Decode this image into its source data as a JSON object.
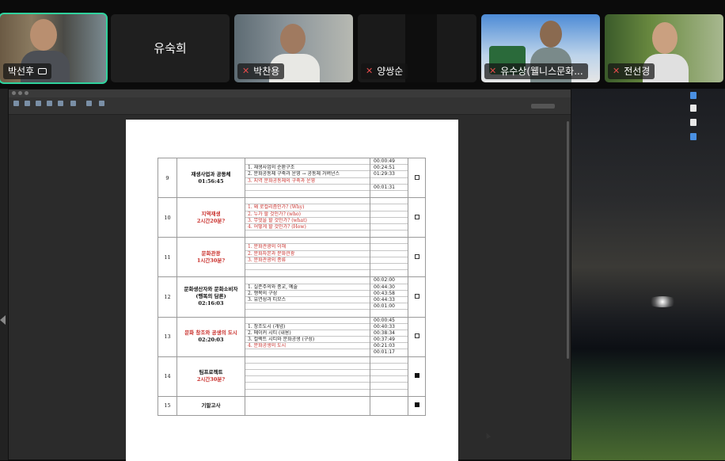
{
  "participants": [
    {
      "name": "박선후",
      "active": true,
      "muted": false,
      "camera": true
    },
    {
      "name": "유숙희",
      "muted": false,
      "video": false
    },
    {
      "name": "박찬용",
      "muted": true
    },
    {
      "name": "양쌍순",
      "muted": true
    },
    {
      "name": "유수상(웰니스문화...",
      "muted": true
    },
    {
      "name": "전선경",
      "muted": true
    }
  ],
  "icons": {
    "mic_off": "mic-off-icon",
    "camera": "camera-icon"
  },
  "colors": {
    "active_speaker": "#2fd29d",
    "red_text": "#c9302c"
  },
  "schedule": {
    "rows": [
      {
        "num": "9",
        "title": "재생사업과 공동체",
        "title_sub": "01:56:45",
        "title_red": false,
        "items": [
          {
            "text": "",
            "red": false
          },
          {
            "text": "1. 재생사업의 순환구조",
            "red": false
          },
          {
            "text": "2. 문화공동체 구축과 운영 → 공동체 거버넌스",
            "red": false
          },
          {
            "text": "3. 지역 문화공동체의 구축과 운영",
            "red": true
          },
          {
            "text": "",
            "red": false
          },
          {
            "text": "",
            "red": false
          }
        ],
        "times": [
          "00:00:49",
          "00:24:51",
          "01:29:33",
          "",
          "00:01:31",
          ""
        ],
        "check": "empty"
      },
      {
        "num": "10",
        "title": "지역재생",
        "title_sub": "2시간20분?",
        "title_red": true,
        "items": [
          {
            "text": "",
            "red": false
          },
          {
            "text": "1. 왜 로컬리즘인가? (Why)",
            "red": true
          },
          {
            "text": "2. 누가 할 것인가? (who)",
            "red": true
          },
          {
            "text": "3. 무엇을 할 것인가? (what)",
            "red": true
          },
          {
            "text": "4. 어떻게 할 것인가? (How)",
            "red": true
          },
          {
            "text": "",
            "red": false
          }
        ],
        "times": [
          "",
          "",
          "",
          "",
          "",
          ""
        ],
        "check": "empty"
      },
      {
        "num": "11",
        "title": "문화관광",
        "title_sub": "1시간30분?",
        "title_red": true,
        "items": [
          {
            "text": "",
            "red": false
          },
          {
            "text": "1. 문화관광의 이해",
            "red": true
          },
          {
            "text": "2. 문화자본과 문화관광",
            "red": true
          },
          {
            "text": "3. 문화관광의 종류",
            "red": true
          },
          {
            "text": "",
            "red": false
          },
          {
            "text": "",
            "red": false
          }
        ],
        "times": [
          "",
          "",
          "",
          "",
          "",
          ""
        ],
        "check": "empty"
      },
      {
        "num": "12",
        "title": "문화생산자와 문화소비자",
        "title_mid": "(행복의 담론)",
        "title_sub": "02:16:03",
        "title_red": false,
        "items": [
          {
            "text": "",
            "red": false
          },
          {
            "text": "1. 실존주의와 종교, 예술",
            "red": false
          },
          {
            "text": "2. 행복의 구성",
            "red": false
          },
          {
            "text": "3. 유연성과 티모스",
            "red": false
          },
          {
            "text": "",
            "red": false
          },
          {
            "text": "",
            "red": false
          }
        ],
        "times": [
          "00:02:00",
          "00:44:30",
          "00:43:58",
          "00:44:33",
          "00:01:00",
          ""
        ],
        "check": "empty"
      },
      {
        "num": "13",
        "title": "문화 창조와 공생의 도시",
        "title_sub": "02:20:03",
        "title_red": true,
        "title_sub_red": false,
        "items": [
          {
            "text": "",
            "red": false
          },
          {
            "text": "1. 창조도시 (개념)",
            "red": false
          },
          {
            "text": "2. 메이커 시티 (내용)",
            "red": false
          },
          {
            "text": "3. 컬렉트 시티와 문화공생 (구성)",
            "red": false
          },
          {
            "text": "4. 문화공생의 도시",
            "red": true
          },
          {
            "text": "",
            "red": false
          }
        ],
        "times": [
          "00:00:45",
          "00:40:33",
          "00:38:34",
          "00:37:49",
          "00:21:03",
          "00:01:17"
        ],
        "check": "empty"
      },
      {
        "num": "14",
        "title": "팀프로젝트",
        "title_sub": "2시간30분?",
        "title_red": false,
        "title_sub_red": true,
        "items": [
          {
            "text": "",
            "red": false
          },
          {
            "text": "",
            "red": false
          },
          {
            "text": "",
            "red": false
          },
          {
            "text": "",
            "red": false
          },
          {
            "text": "",
            "red": false
          },
          {
            "text": "",
            "red": false
          }
        ],
        "times": [
          "",
          "",
          "",
          "",
          "",
          ""
        ],
        "check": "filled"
      },
      {
        "num": "15",
        "title": "기말고사",
        "title_sub": "",
        "title_red": false,
        "items": [],
        "times": [],
        "check": "filled"
      }
    ]
  }
}
